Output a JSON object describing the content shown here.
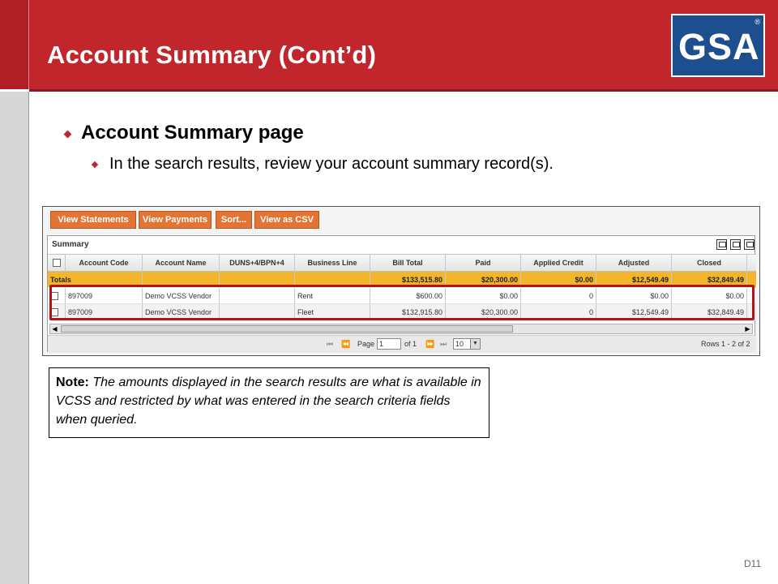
{
  "slide": {
    "title": "Account Summary (Cont’d)",
    "logo": "GSA",
    "logo_mark": "®",
    "bullet_1": "Account Summary page",
    "bullet_2": "In the search results, review your account summary record(s).",
    "note_label": "Note:",
    "note_text": "  The amounts displayed in the search results are what is available in VCSS and restricted by what was entered in the search criteria fields when queried.",
    "page_number": "D11"
  },
  "toolbar": {
    "view_statements": "View Statements",
    "view_payments": "View Payments",
    "sort": "Sort...",
    "view_csv": "View as CSV"
  },
  "panel": {
    "title": "Summary"
  },
  "table": {
    "columns": [
      "Account Code",
      "Account Name",
      "DUNS+4/BPN+4",
      "Business Line",
      "Bill Total",
      "Paid",
      "Applied Credit",
      "Adjusted",
      "Closed"
    ],
    "totals": {
      "label": "Totals",
      "bill_total": "$133,515.80",
      "paid": "$20,300.00",
      "applied_credit": "$0.00",
      "adjusted": "$12,549.49",
      "closed": "$32,849.49"
    },
    "rows": [
      {
        "account_code": "897009",
        "account_name": "Demo VCSS Vendor",
        "duns": "",
        "business_line": "Rent",
        "bill_total": "$600.00",
        "paid": "$0.00",
        "applied_credit": "0",
        "adjusted": "$0.00",
        "closed": "$0.00"
      },
      {
        "account_code": "897009",
        "account_name": "Demo VCSS Vendor",
        "duns": "",
        "business_line": "Fleet",
        "bill_total": "$132,915.80",
        "paid": "$20,300.00",
        "applied_credit": "0",
        "adjusted": "$12,549.49",
        "closed": "$32,849.49"
      }
    ]
  },
  "pager": {
    "page_label": "Page",
    "page_value": "1",
    "of_label": "of 1",
    "page_size": "10",
    "rows_label": "Rows 1 - 2 of 2"
  },
  "colors": {
    "header_red": "#c1262d",
    "logo_blue": "#1d4f8f",
    "button_orange": "#e27434",
    "totals_yellow": "#f3b62a",
    "highlight_red": "#b3121b"
  }
}
